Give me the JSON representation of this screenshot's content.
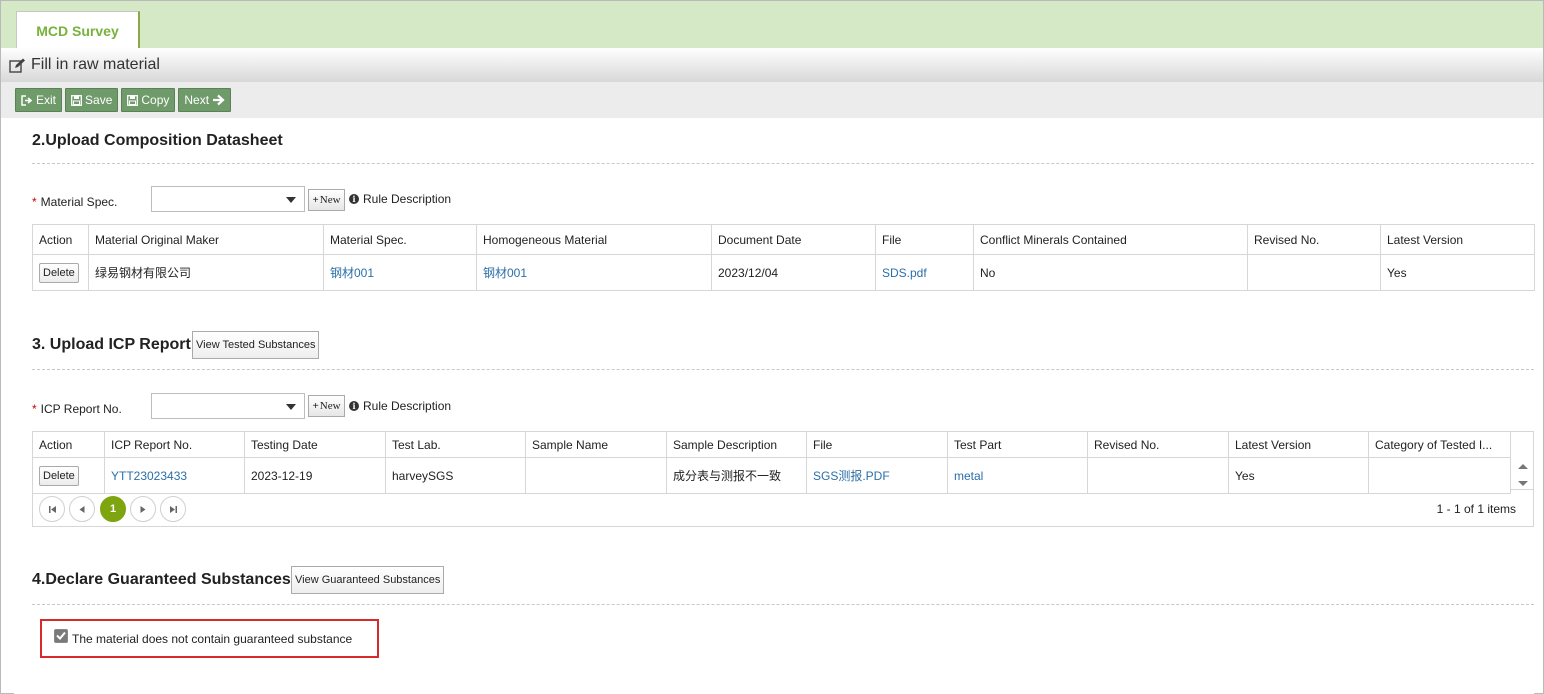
{
  "tab": {
    "label": "MCD Survey"
  },
  "page": {
    "title": "Fill in raw material"
  },
  "toolbar": {
    "exit": "Exit",
    "save": "Save",
    "copy": "Copy",
    "next": "Next"
  },
  "section2": {
    "title": "2.Upload Composition Datasheet",
    "field_label": "Material Spec.",
    "new_label": "New",
    "rule_label": "Rule Description",
    "columns": [
      "Action",
      "Material Original Maker",
      "Material Spec.",
      "Homogeneous Material",
      "Document Date",
      "File",
      "Conflict Minerals Contained",
      "Revised No.",
      "Latest Version"
    ],
    "row": {
      "action": "Delete",
      "maker": "绿易钢材有限公司",
      "spec": "钢材001",
      "homogeneous": "钢材001",
      "date": "2023/12/04",
      "file": "SDS.pdf",
      "conflict": "No",
      "revised": "",
      "latest": "Yes"
    }
  },
  "section3": {
    "title": "3. Upload ICP Report",
    "view_button": "View Tested Substances",
    "field_label": "ICP Report No.",
    "new_label": "New",
    "rule_label": "Rule Description",
    "columns": [
      "Action",
      "ICP Report No.",
      "Testing Date",
      "Test Lab.",
      "Sample Name",
      "Sample Description",
      "File",
      "Test Part",
      "Revised No.",
      "Latest Version",
      "Category of Tested I..."
    ],
    "row": {
      "action": "Delete",
      "report_no": "YTT23023433",
      "testing_date": "2023-12-19",
      "lab": "harveySGS",
      "sample_name": "",
      "sample_desc": "成分表与测报不一致",
      "file": "SGS测报.PDF",
      "test_part": "metal",
      "revised": "",
      "latest": "Yes",
      "category": ""
    },
    "pager": {
      "current_page": "1",
      "info": "1 - 1 of 1 items"
    }
  },
  "section4": {
    "title": "4.Declare Guaranteed Substances",
    "view_button": "View Guaranteed Substances",
    "checkbox_label": "The material does not contain guaranteed substance",
    "checked": true
  }
}
